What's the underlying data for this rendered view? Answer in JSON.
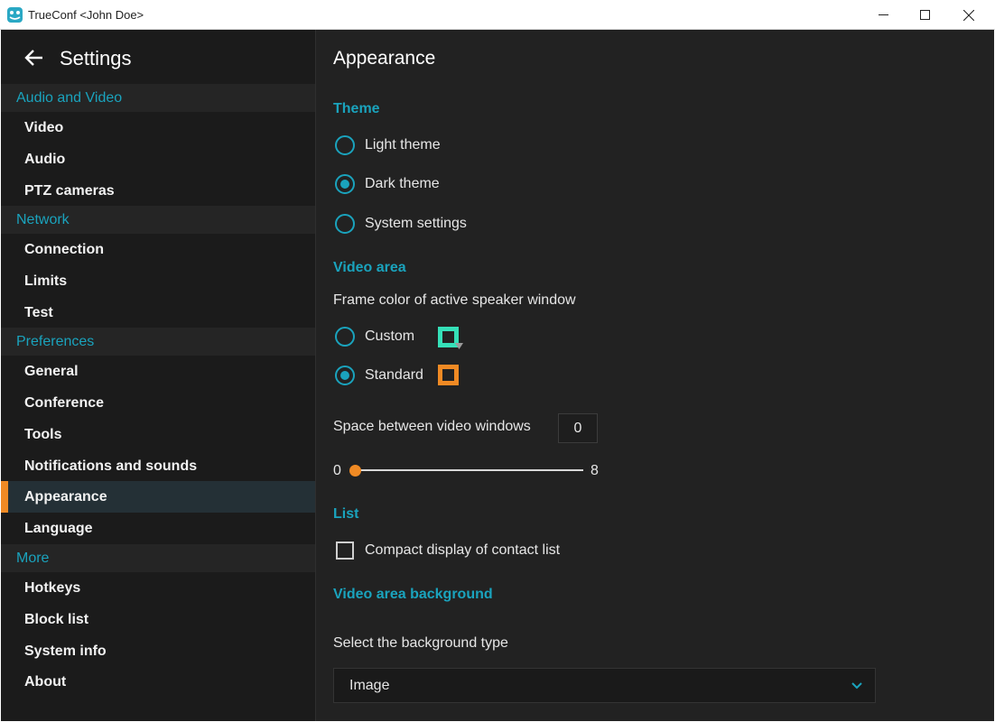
{
  "window": {
    "title": "TrueConf <John Doe>"
  },
  "sidebar": {
    "title": "Settings",
    "sections": [
      {
        "header": "Audio and Video",
        "items": [
          "Video",
          "Audio",
          "PTZ cameras"
        ]
      },
      {
        "header": "Network",
        "items": [
          "Connection",
          "Limits",
          "Test"
        ]
      },
      {
        "header": "Preferences",
        "items": [
          "General",
          "Conference",
          "Tools",
          "Notifications and sounds",
          "Appearance",
          "Language"
        ]
      },
      {
        "header": "More",
        "items": [
          "Hotkeys",
          "Block list",
          "System info",
          "About"
        ]
      }
    ],
    "active_item": "Appearance"
  },
  "main": {
    "title": "Appearance",
    "theme": {
      "header": "Theme",
      "options": [
        "Light theme",
        "Dark theme",
        "System settings"
      ],
      "selected": "Dark theme"
    },
    "video_area": {
      "header": "Video area",
      "frame_color_label": "Frame color of active speaker window",
      "frame_options": [
        "Custom",
        "Standard"
      ],
      "selected": "Standard",
      "custom_color": "#35e0b8",
      "standard_color": "#f08a24",
      "space_label": "Space between video windows",
      "space_value": "0",
      "slider_min": "0",
      "slider_max": "8",
      "slider_value": 0
    },
    "list": {
      "header": "List",
      "compact_label": "Compact display of contact list",
      "compact_checked": false
    },
    "background": {
      "header": "Video area background",
      "select_label": "Select the background type",
      "selected": "Image"
    }
  },
  "colors": {
    "accent": "#1aa3bd",
    "active_marker": "#f08a24",
    "sidebar_bg": "#1b1b1b",
    "main_bg": "#222222"
  },
  "icons": {
    "back": "back-arrow-icon",
    "minimize": "minimize-icon",
    "maximize": "maximize-icon",
    "close": "close-icon",
    "dropdown": "chevron-down-icon"
  }
}
